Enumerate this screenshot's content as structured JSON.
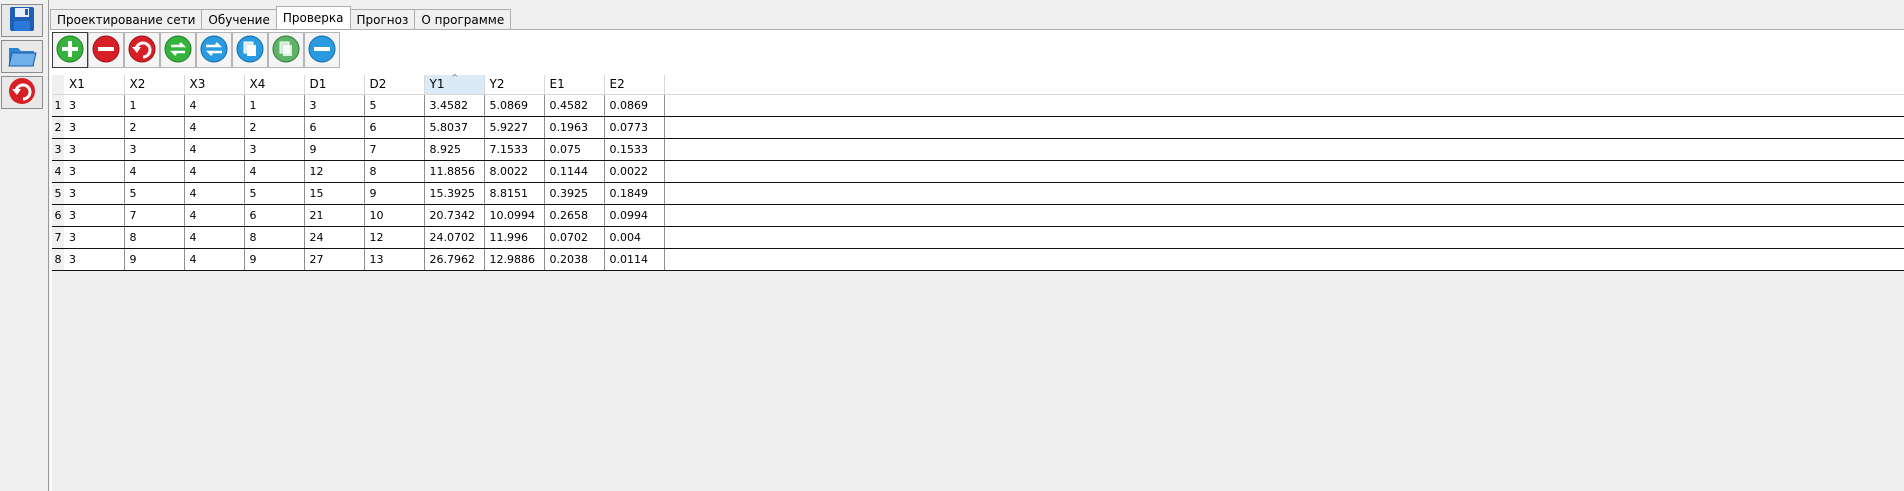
{
  "tabs": [
    "Проектирование сети",
    "Обучение",
    "Проверка",
    "Прогноз",
    "О программе"
  ],
  "active_tab": "Проверка",
  "left_toolbar": [
    "save-icon",
    "open-folder-icon",
    "undo-icon"
  ],
  "toolbar_icons": [
    "add-icon",
    "remove-icon",
    "undo-icon",
    "refresh-icon",
    "transfer-icon",
    "copy-icon",
    "duplicate-icon",
    "minus-icon"
  ],
  "table": {
    "columns": [
      "X1",
      "X2",
      "X3",
      "X4",
      "D1",
      "D2",
      "Y1",
      "Y2",
      "E1",
      "E2"
    ],
    "sorted_column": "Y1",
    "row_numbers": [
      "1",
      "2",
      "3",
      "4",
      "5",
      "6",
      "7",
      "8"
    ],
    "rows": [
      [
        "3",
        "1",
        "4",
        "1",
        "3",
        "5",
        "3.4582",
        "5.0869",
        "0.4582",
        "0.0869"
      ],
      [
        "3",
        "2",
        "4",
        "2",
        "6",
        "6",
        "5.8037",
        "5.9227",
        "0.1963",
        "0.0773"
      ],
      [
        "3",
        "3",
        "4",
        "3",
        "9",
        "7",
        "8.925",
        "7.1533",
        "0.075",
        "0.1533"
      ],
      [
        "3",
        "4",
        "4",
        "4",
        "12",
        "8",
        "11.8856",
        "8.0022",
        "0.1144",
        "0.0022"
      ],
      [
        "3",
        "5",
        "4",
        "5",
        "15",
        "9",
        "15.3925",
        "8.8151",
        "0.3925",
        "0.1849"
      ],
      [
        "3",
        "7",
        "4",
        "6",
        "21",
        "10",
        "20.7342",
        "10.0994",
        "0.2658",
        "0.0994"
      ],
      [
        "3",
        "8",
        "4",
        "8",
        "24",
        "12",
        "24.0702",
        "11.996",
        "0.0702",
        "0.004"
      ],
      [
        "3",
        "9",
        "4",
        "9",
        "27",
        "13",
        "26.7962",
        "12.9886",
        "0.2038",
        "0.0114"
      ]
    ]
  }
}
